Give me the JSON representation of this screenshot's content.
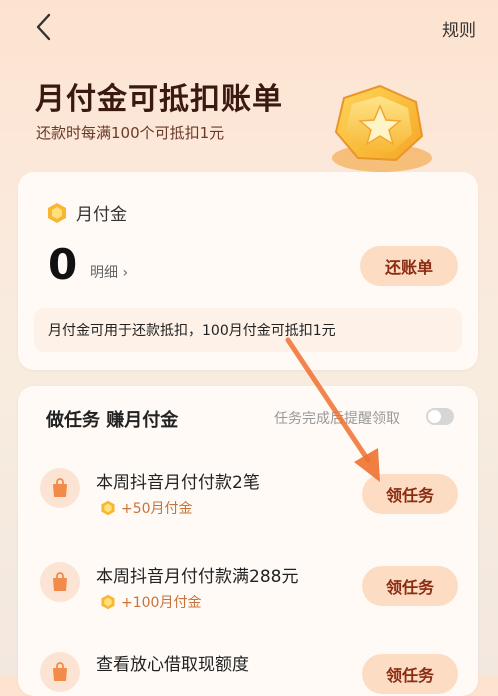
{
  "header": {
    "back_icon": "chevron-left-icon",
    "rules_label": "规则"
  },
  "hero": {
    "title": "月付金可抵扣账单",
    "subtitle": "还款时每满100个可抵扣1元",
    "coin_icon": "star-coin-icon"
  },
  "balance_card": {
    "label": "月付金",
    "amount": "0",
    "detail_label": "明细 ›",
    "repay_button": "还账单",
    "note": "月付金可用于还款抵扣，100月付金可抵扣1元"
  },
  "tasks_card": {
    "title": "做任务 赚月付金",
    "remind_label": "任务完成后提醒领取",
    "remind_toggle": "off",
    "tasks": [
      {
        "title": "本周抖音月付付款2笔",
        "reward": "+50月付金",
        "button": "领任务",
        "icon": "shopping-bag-icon"
      },
      {
        "title": "本周抖音月付付款满288元",
        "reward": "+100月付金",
        "button": "领任务",
        "icon": "shopping-bag-icon"
      },
      {
        "title": "查看放心借取现额度",
        "reward": "",
        "button": "领任务",
        "icon": "shopping-bag-icon"
      }
    ]
  },
  "colors": {
    "accent": "#8a2c12",
    "button_bg": "#fddcc4",
    "reward": "#c6743a",
    "arrow": "#f07030"
  }
}
